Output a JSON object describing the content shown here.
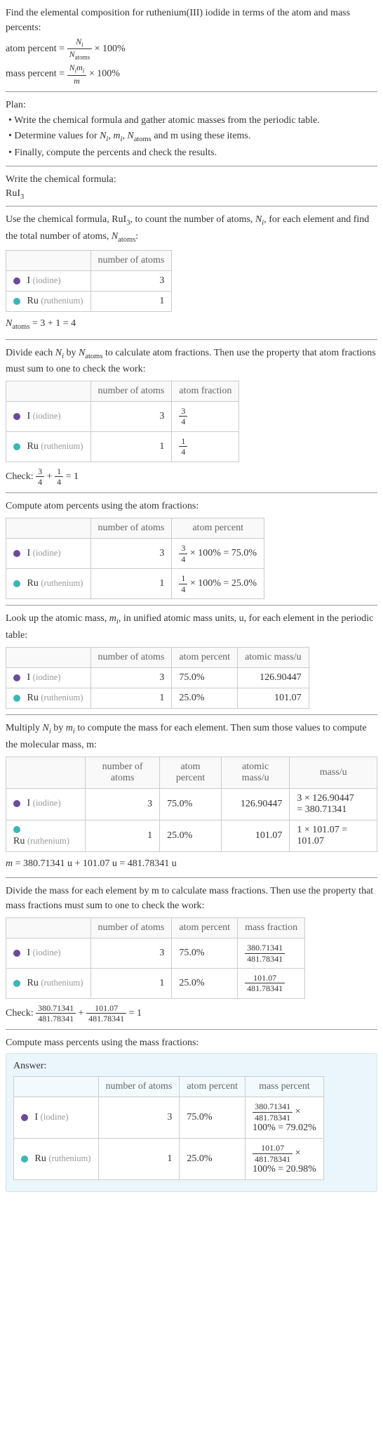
{
  "intro": {
    "header": "Find the elemental composition for ruthenium(III) iodide in terms of the atom and mass percents:",
    "atom_pct_lhs": "atom percent =",
    "mass_pct_lhs": "mass percent =",
    "frac1_num": "N_i",
    "frac1_den": "N_atoms",
    "frac2_num": "N_i m_i",
    "frac2_den": "m",
    "times100": " × 100%"
  },
  "plan": {
    "label": "Plan:",
    "b1": "• Write the chemical formula and gather atomic masses from the periodic table.",
    "b2_pre": "• Determine values for ",
    "b2_vars": "N_i, m_i, N_atoms",
    "b2_post": " and m using these items.",
    "b3": "• Finally, compute the percents and check the results."
  },
  "step1": {
    "label": "Write the chemical formula:",
    "formula": "RuI",
    "sub": "3"
  },
  "step2": {
    "intro_pre": "Use the chemical formula, RuI",
    "intro_sub": "3",
    "intro_mid": ", to count the number of atoms, ",
    "intro_var1": "N_i",
    "intro_mid2": ", for each element and find the total number of atoms, ",
    "intro_var2": "N_atoms",
    "intro_end": ":",
    "col1": "",
    "col2": "number of atoms",
    "i_sym": "I",
    "i_name": "(iodine)",
    "i_atoms": "3",
    "ru_sym": "Ru",
    "ru_name": "(ruthenium)",
    "ru_atoms": "1",
    "sum_eq": "N_atoms = 3 + 1 = 4",
    "sum_lhs": "N",
    "sum_lhs_sub": "atoms",
    "sum_rhs": " = 3 + 1 = 4"
  },
  "step3": {
    "intro_pre": "Divide each ",
    "intro_v1": "N_i",
    "intro_mid": " by ",
    "intro_v2": "N_atoms",
    "intro_post": " to calculate atom fractions. Then use the property that atom fractions must sum to one to check the work:",
    "col2": "number of atoms",
    "col3": "atom fraction",
    "i_atoms": "3",
    "i_frac_num": "3",
    "i_frac_den": "4",
    "ru_atoms": "1",
    "ru_frac_num": "1",
    "ru_frac_den": "4",
    "check_pre": "Check: ",
    "check_f1n": "3",
    "check_f1d": "4",
    "check_plus": " + ",
    "check_f2n": "1",
    "check_f2d": "4",
    "check_rhs": " = 1"
  },
  "step4": {
    "intro": "Compute atom percents using the atom fractions:",
    "col2": "number of atoms",
    "col3": "atom percent",
    "i_atoms": "3",
    "i_fn": "3",
    "i_fd": "4",
    "i_tail": " × 100% = 75.0%",
    "ru_atoms": "1",
    "ru_fn": "1",
    "ru_fd": "4",
    "ru_tail": " × 100% = 25.0%"
  },
  "step5": {
    "intro_pre": "Look up the atomic mass, ",
    "intro_var": "m_i",
    "intro_post": ", in unified atomic mass units, u, for each element in the periodic table:",
    "col2": "number of atoms",
    "col3": "atom percent",
    "col4": "atomic mass/u",
    "i_atoms": "3",
    "i_pct": "75.0%",
    "i_mass": "126.90447",
    "ru_atoms": "1",
    "ru_pct": "25.0%",
    "ru_mass": "101.07"
  },
  "step6": {
    "intro_pre": "Multiply ",
    "intro_v1": "N_i",
    "intro_mid": " by ",
    "intro_v2": "m_i",
    "intro_post": " to compute the mass for each element. Then sum those values to compute the molecular mass, m:",
    "col2": "number of atoms",
    "col3": "atom percent",
    "col4": "atomic mass/u",
    "col5": "mass/u",
    "i_atoms": "3",
    "i_pct": "75.0%",
    "i_amass": "126.90447",
    "i_m1": "3 × 126.90447",
    "i_m2": "= 380.71341",
    "ru_atoms": "1",
    "ru_pct": "25.0%",
    "ru_amass": "101.07",
    "ru_m": "1 × 101.07 = 101.07",
    "sum_eq": "m = 380.71341 u + 101.07 u = 481.78341 u"
  },
  "step7": {
    "intro": "Divide the mass for each element by m to calculate mass fractions. Then use the property that mass fractions must sum to one to check the work:",
    "col2": "number of atoms",
    "col3": "atom percent",
    "col4": "mass fraction",
    "i_atoms": "3",
    "i_pct": "75.0%",
    "i_fn": "380.71341",
    "i_fd": "481.78341",
    "ru_atoms": "1",
    "ru_pct": "25.0%",
    "ru_fn": "101.07",
    "ru_fd": "481.78341",
    "check_pre": "Check: ",
    "check_f1n": "380.71341",
    "check_f1d": "481.78341",
    "check_plus": " + ",
    "check_f2n": "101.07",
    "check_f2d": "481.78341",
    "check_rhs": " = 1"
  },
  "step8": {
    "intro": "Compute mass percents using the mass fractions:"
  },
  "answer": {
    "label": "Answer:",
    "col2": "number of atoms",
    "col3": "atom percent",
    "col4": "mass percent",
    "i_atoms": "3",
    "i_pct": "75.0%",
    "i_fn": "380.71341",
    "i_fd": "481.78341",
    "i_x": " ×",
    "i_tail": "100% = 79.02%",
    "ru_atoms": "1",
    "ru_pct": "25.0%",
    "ru_fn": "101.07",
    "ru_fd": "481.78341",
    "ru_x": " ×",
    "ru_tail": "100% = 20.98%"
  },
  "elements": {
    "i_sym": "I",
    "i_name": "(iodine)",
    "ru_sym": "Ru",
    "ru_name": "(ruthenium)"
  }
}
